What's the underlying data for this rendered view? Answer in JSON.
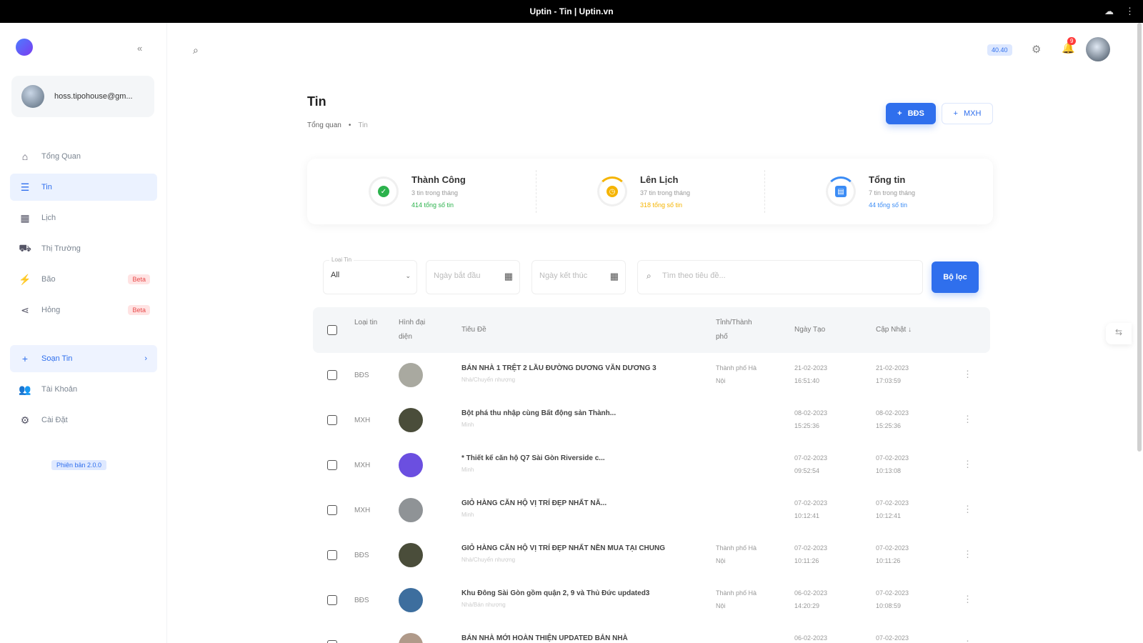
{
  "window": {
    "title": "Uptin - Tin | Uptin.vn"
  },
  "sidebar": {
    "account_name": "hoss.tipohouse@gm...",
    "nav": [
      {
        "label": "Tổng Quan",
        "icon": "home-icon"
      },
      {
        "label": "Tin",
        "icon": "list-icon",
        "active": true
      },
      {
        "label": "Lịch",
        "icon": "calendar-icon"
      },
      {
        "label": "Thị Trường",
        "icon": "market-icon"
      },
      {
        "label": "Bão",
        "icon": "lightning-icon",
        "badge": "Beta"
      },
      {
        "label": "Hỏng",
        "icon": "share-icon",
        "badge": "Beta"
      }
    ],
    "compose_label": "Soạn Tin",
    "account_nav": [
      {
        "label": "Tài Khoản",
        "icon": "users-icon"
      },
      {
        "label": "Cài Đặt",
        "icon": "gear-icon"
      }
    ],
    "version": "Phiên bản 2.0.0"
  },
  "header": {
    "credits": "40.40",
    "notifications": "9"
  },
  "page": {
    "title": "Tin",
    "breadcrumb": [
      "Tổng quan",
      "Tin"
    ],
    "btn_bds": "BĐS",
    "btn_mxh": "MXH"
  },
  "stats": [
    {
      "title": "Thành Công",
      "sub": "3 tin trong tháng",
      "total": "414 tổng số tin",
      "color": "#2bb24c"
    },
    {
      "title": "Lên Lịch",
      "sub": "37 tin trong tháng",
      "total": "318 tổng số tin",
      "color": "#f5b400"
    },
    {
      "title": "Tổng tin",
      "sub": "7 tin trong tháng",
      "total": "44 tổng số tin",
      "color": "#3b8cf5"
    }
  ],
  "filters": {
    "type_label": "Loại Tin",
    "type_value": "All",
    "start_placeholder": "Ngày bắt đầu",
    "end_placeholder": "Ngày kết thúc",
    "search_placeholder": "Tìm theo tiêu đề...",
    "apply": "Bộ lọc"
  },
  "table": {
    "headers": [
      "Loại tin",
      "Hình đại diện",
      "Tiêu Đề",
      "Tỉnh/Thành phố",
      "Ngày Tạo",
      "Cập Nhật"
    ],
    "rows": [
      {
        "type": "BĐS",
        "title": "BÁN NHÀ 1 TRỆT 2 LẦU ĐƯỜNG DƯƠNG VĂN DƯƠNG 3",
        "sub": "Nhà/Chuyển nhượng",
        "city": "Thành phố Hà Nội",
        "created": "21-02-2023 16:51:40",
        "updated": "21-02-2023 17:03:59",
        "thumb": "#a9a9a0"
      },
      {
        "type": "MXH",
        "title": "Bột phá thu nhập cùng Bất động sản Thành...",
        "sub": "Minh",
        "city": "",
        "created": "08-02-2023 15:25:36",
        "updated": "08-02-2023 15:25:36",
        "thumb": "#4a4d3a"
      },
      {
        "type": "MXH",
        "title": "* Thiết kế căn hộ Q7 Sài Gòn Riverside c...",
        "sub": "Minh",
        "city": "",
        "created": "07-02-2023 09:52:54",
        "updated": "07-02-2023 10:13:08",
        "thumb": "#6b4fe0"
      },
      {
        "type": "MXH",
        "title": " GIỎ HÀNG CĂN HỘ VỊ TRÍ ĐẸP NHẤT NĂ...",
        "sub": "Minh",
        "city": "",
        "created": "07-02-2023 10:12:41",
        "updated": "07-02-2023 10:12:41",
        "thumb": "#8f9396"
      },
      {
        "type": "BĐS",
        "title": "GIỎ HÀNG CĂN HỘ VỊ TRÍ ĐẸP NHẤT NỀN MUA TẠI CHUNG",
        "sub": "Nhà/Chuyển nhượng",
        "city": "Thành phố Hà Nội",
        "created": "07-02-2023 10:11:26",
        "updated": "07-02-2023 10:11:26",
        "thumb": "#4a4d3a"
      },
      {
        "type": "BĐS",
        "title": "Khu Đông Sài Gòn gồm quận 2, 9 và Thủ Đức updated3",
        "sub": "Nhà/Bán nhượng",
        "city": "Thành phố Hà Nội",
        "created": "06-02-2023 14:20:29",
        "updated": "07-02-2023 10:08:59",
        "thumb": "#3d6e9e"
      },
      {
        "type": "",
        "title": "BÁN NHÀ MỚI HOÀN THIỆN UPDATED BẢN NHÀ",
        "sub": "",
        "city": "",
        "created": "06-02-2023",
        "updated": "07-02-2023",
        "thumb": "#b09a8a"
      }
    ]
  }
}
